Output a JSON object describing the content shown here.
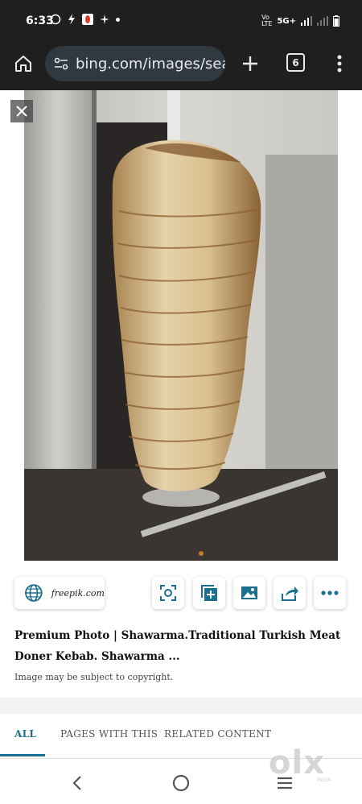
{
  "status_bar": {
    "time": "6:33",
    "network": "5G+",
    "left_icons": [
      "whatsapp-icon",
      "bolt-icon",
      "app-icon",
      "pinwheel-icon",
      "dot-icon"
    ],
    "right_icons": [
      "volte-icon",
      "signal-icon",
      "signal-icon-2",
      "battery-icon"
    ]
  },
  "browser": {
    "url": "bing.com/images/sear",
    "tab_count": "6",
    "accent": "#1f1f1f"
  },
  "image_viewer": {
    "source": "freepik.com",
    "title": "Premium Photo | Shawarma.Traditional Turkish Meat Doner Kebab. Shawarma ...",
    "copyright_note": "Image may be subject to copyright.",
    "actions": [
      "visual-search",
      "add-to-collection",
      "image",
      "share",
      "more"
    ]
  },
  "tabs": {
    "all": "ALL",
    "pages": "PAGES WITH THIS",
    "related": "RELATED CONTENT",
    "active_color": "#1b6f8f"
  },
  "watermark": {
    "brand": "olx",
    "sub": "INDIA"
  }
}
